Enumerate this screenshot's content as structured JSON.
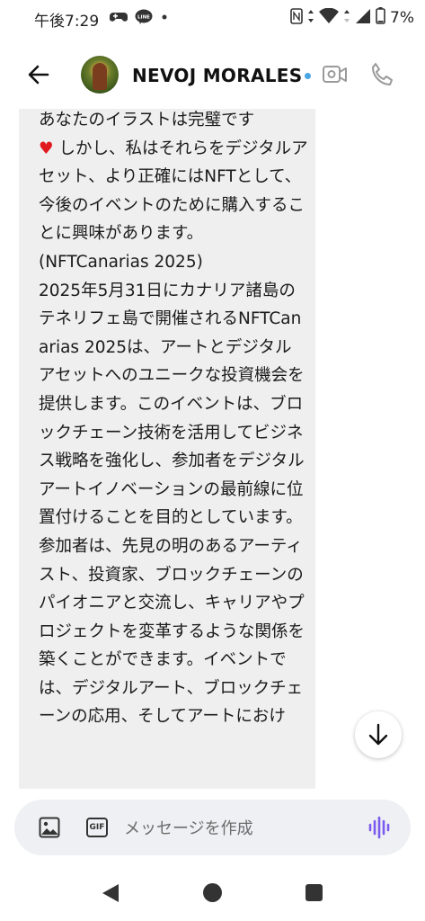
{
  "status_bar": {
    "time": "午後7:29",
    "battery": "7%",
    "icons": [
      "game-controller-icon",
      "line-app-icon",
      "dot-icon",
      "nfc-icon",
      "data-arrows-icon",
      "wifi-icon",
      "data-arrows-icon",
      "signal-icon",
      "battery-icon"
    ]
  },
  "header": {
    "contact_name": "NEVOJ MORALES",
    "verified_color": "#49a6e3"
  },
  "message": {
    "line_before_heart": "あなたのイラストは完璧です",
    "heart": "♥",
    "body": " しかし、私はそれらをデジタルアセット、より正確にはNFTとして、今後のイベントのために購入することに興味があります。\n(NFTCanarias 2025)\n2025年5月31日にカナリア諸島のテネリフェ島で開催されるNFTCanarias 2025は、アートとデジタルアセットへのユニークな投資機会を提供します。このイベントは、ブロックチェーン技術を活用してビジネス戦略を強化し、参加者をデジタルアートイノベーションの最前線に位置付けることを目的としています。参加者は、先見の明のあるアーティスト、投資家、ブロックチェーンのパイオニアと交流し、キャリアやプロジェクトを変革するような関係を築くことができます。イベントでは、デジタルアート、ブロックチェーンの応用、そしてアートにおけ"
  },
  "composer": {
    "placeholder": "メッセージを作成",
    "gif_label": "GIF",
    "accent_color": "#7b5cf0"
  }
}
